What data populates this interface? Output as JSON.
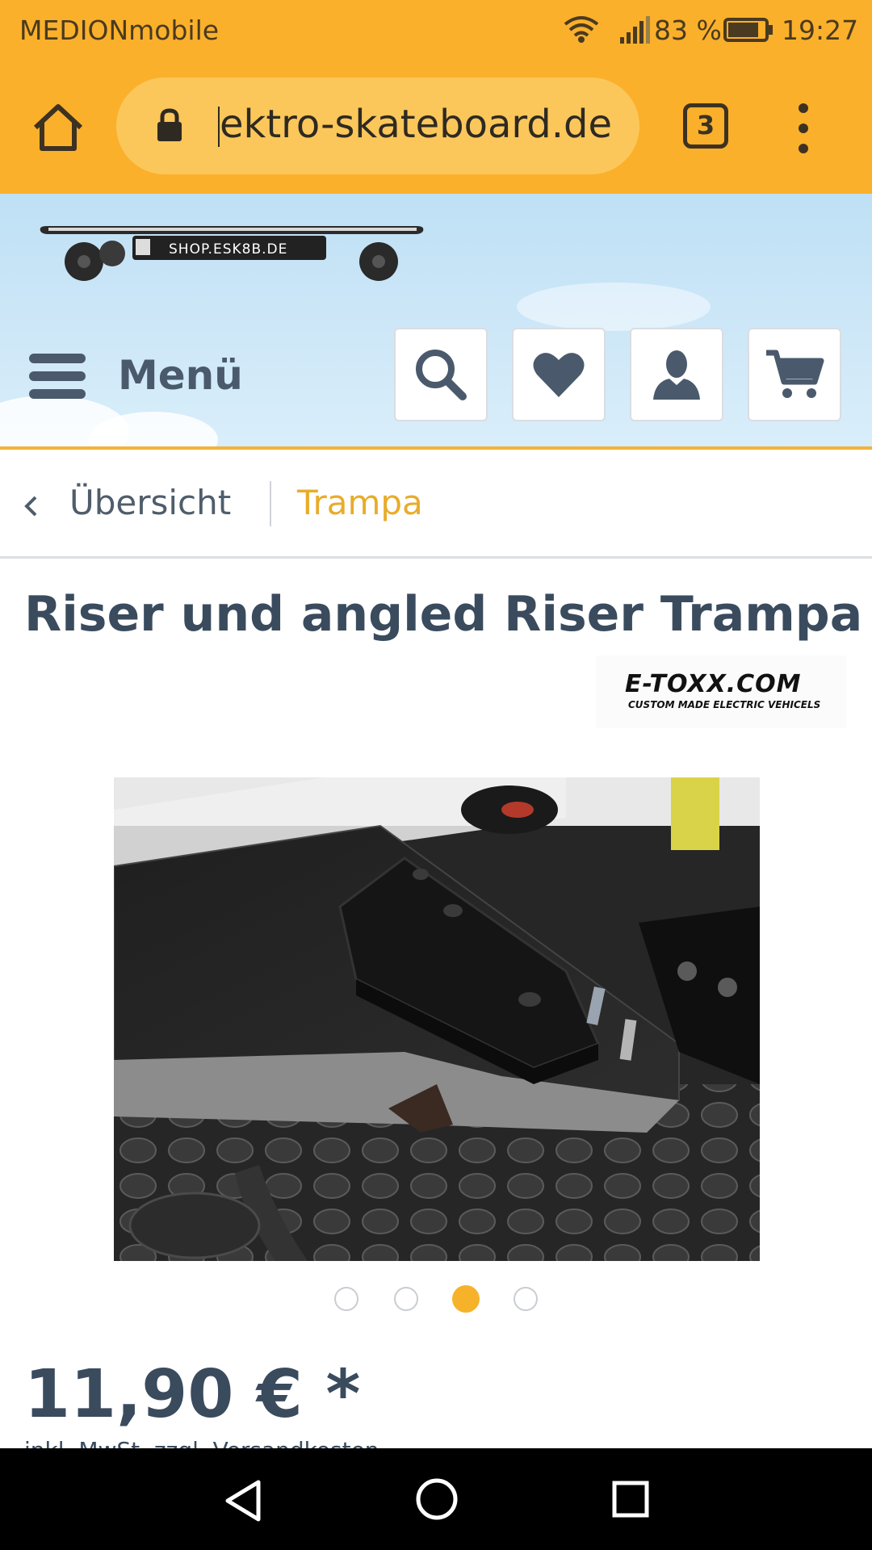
{
  "status_bar": {
    "carrier": "MEDIONmobile",
    "battery_percent": "83 %",
    "battery_level": 0.83,
    "time": "19:27",
    "icons": [
      "wifi-icon",
      "signal-icon",
      "battery-icon"
    ]
  },
  "browser": {
    "url": "ektro-skateboard.de",
    "tab_count": "3",
    "icons": [
      "home-icon",
      "lock-icon",
      "more-vert-icon"
    ],
    "accent_color": "#fbb02b"
  },
  "site_header": {
    "logo_text": "SHOP.ESK8B.DE",
    "menu_label": "Menü",
    "buttons": [
      "search-icon",
      "heart-icon",
      "user-icon",
      "cart-icon"
    ]
  },
  "breadcrumb": {
    "back_label": "Übersicht",
    "current": "Trampa",
    "current_color": "#e8ac2b"
  },
  "product": {
    "title": "Riser und angled Riser Trampa",
    "brand_name": "E-TOXX.COM",
    "brand_tagline": "CUSTOM MADE ELECTRIC VEHICELS",
    "image_count": 4,
    "active_image": 3,
    "price": "11,90 € *",
    "price_note": "inkl. MwSt. zzgl. Versandkosten"
  },
  "nav_bar": {
    "icons": [
      "back-icon",
      "home-circle-icon",
      "recents-icon"
    ]
  }
}
